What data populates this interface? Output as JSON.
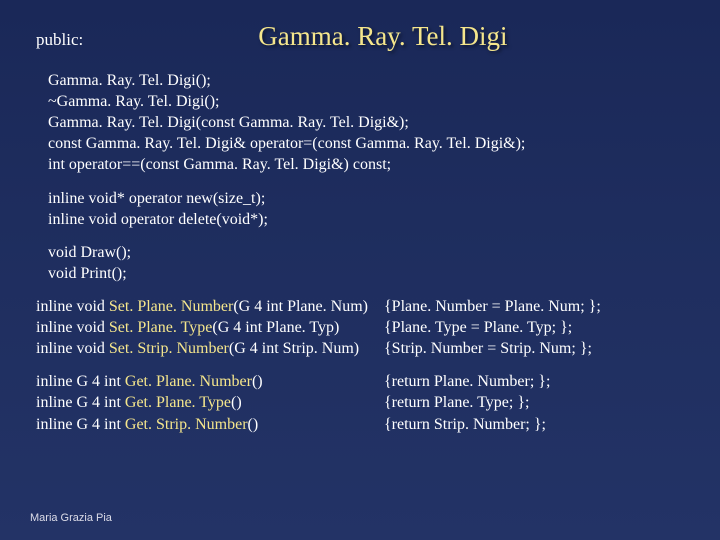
{
  "header": {
    "public_label": "public:",
    "title": "Gamma. Ray. Tel. Digi"
  },
  "block1": {
    "l1": "Gamma. Ray. Tel. Digi();",
    "l2": "~Gamma. Ray. Tel. Digi();",
    "l3": "Gamma. Ray. Tel. Digi(const Gamma. Ray. Tel. Digi&);",
    "l4": "const Gamma. Ray. Tel. Digi& operator=(const Gamma. Ray. Tel. Digi&);",
    "l5": "int operator==(const Gamma. Ray. Tel. Digi&) const;"
  },
  "block2": {
    "l1a": "inline void* operator ",
    "l1b": "new",
    "l1c": "(size_t);",
    "l2a": "inline void  operator ",
    "l2b": "delete",
    "l2c": "(void*);"
  },
  "block3": {
    "l1a": "void ",
    "l1b": "Draw",
    "l1c": "();",
    "l2a": "void ",
    "l2b": "Print",
    "l2c": "();"
  },
  "block4": {
    "r1": {
      "pre": "inline void ",
      "fn": "Set. Plane. Number",
      "args": "(G 4 int Plane. Num)",
      "body": "{Plane. Number = Plane. Num; };"
    },
    "r2": {
      "pre": "inline void ",
      "fn": "Set. Plane. Type",
      "args": "(G 4 int Plane. Typ)",
      "body": "{Plane. Type = Plane. Typ; };"
    },
    "r3": {
      "pre": "inline void ",
      "fn": "Set. Strip. Number",
      "args": "(G 4 int Strip. Num)",
      "body": "{Strip. Number = Strip. Num; };"
    }
  },
  "block5": {
    "r1": {
      "pre": "inline G 4 int ",
      "fn": "Get. Plane. Number",
      "args": "()",
      "body": "{return Plane. Number; };"
    },
    "r2": {
      "pre": "inline G 4 int ",
      "fn": "Get. Plane. Type",
      "args": "()",
      "body": "{return Plane. Type; };"
    },
    "r3": {
      "pre": "inline G 4 int ",
      "fn": "Get. Strip. Number",
      "args": "()",
      "body": "{return Strip. Number; };"
    }
  },
  "footer": "Maria Grazia Pia"
}
